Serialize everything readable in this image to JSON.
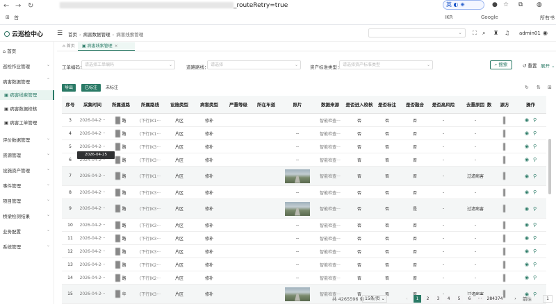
{
  "browser": {
    "url_tail": "_routeRetry=true",
    "bookmark_text": "首",
    "bookmark_ikrr": "IKR",
    "bookmark_google": "Google",
    "bookmark_all": "所有书",
    "translate_label": "英"
  },
  "app": {
    "title": "云巡检中心",
    "user": "admin01"
  },
  "breadcrumb": {
    "home": "首页",
    "level1": "病害数据管理",
    "current": "病害线索管理"
  },
  "tabs": {
    "home": "首页",
    "active": "病害线索管理",
    "close": "×"
  },
  "sidebar": {
    "home": "首页",
    "items": [
      "巡检作业管理",
      "病害数据管理",
      "评价数据管理",
      "资源管理",
      "设施资产管理",
      "事件管理",
      "项目管理",
      "桥梁检测结果",
      "业务配置",
      "系统管理"
    ],
    "subitems": [
      "病害线索管理",
      "病害数据校核",
      "病害工单管理"
    ]
  },
  "filters": {
    "order_label": "工单编码：",
    "order_placeholder": "请选择工单编码",
    "road_label": "道路路线：",
    "road_placeholder": "请选择",
    "asset_label": "资产标准类型：",
    "asset_placeholder": "请选择资产标准类型",
    "search": "搜索",
    "reset": "重置",
    "expand": "展开"
  },
  "actions": {
    "export": "导出",
    "marked": "已标注",
    "unmarked": "未标注"
  },
  "table": {
    "headers": [
      "序号",
      "采集时间",
      "所属道路",
      "所属路线",
      "设施类型",
      "病害类型",
      "严重等级",
      "所在车道",
      "照片",
      "数据来源",
      "是否进入校核",
      "是否标注",
      "是否融合",
      "是否高风险",
      "去重原因",
      "数",
      "源方",
      "操作"
    ],
    "rows": [
      {
        "no": "3",
        "time": "2026-04-2···",
        "road": "路",
        "route": "(下行)K1···",
        "fac": "片区",
        "type": "修补",
        "photo": "",
        "photo_on": false,
        "src": "智能检查···",
        "chk": "否",
        "mark": "否",
        "fuse": "否",
        "risk": "-",
        "reason": "-"
      },
      {
        "no": "4",
        "time": "2026-04-2···",
        "road": "路",
        "route": "(下行)K1···",
        "fac": "片区",
        "type": "修补",
        "photo": "--",
        "photo_on": false,
        "src": "智能检查···",
        "chk": "否",
        "mark": "否",
        "fuse": "否",
        "risk": "-",
        "reason": "-"
      },
      {
        "no": "5",
        "time": "2026-04-2···",
        "road": "路",
        "route": "(下行)K3···",
        "fac": "片区",
        "type": "修补",
        "photo": "--",
        "photo_on": false,
        "src": "智能检查···",
        "chk": "否",
        "mark": "否",
        "fuse": "否",
        "risk": "-",
        "reason": "-"
      },
      {
        "no": "6",
        "time": "2026-04-2···",
        "road": "路",
        "route": "(下行)K3···",
        "fac": "片区",
        "type": "修补",
        "photo": "--",
        "photo_on": false,
        "src": "智能检查···",
        "chk": "否",
        "mark": "否",
        "fuse": "否",
        "risk": "-",
        "reason": "-"
      },
      {
        "no": "7",
        "time": "2026-04-2···",
        "road": "路",
        "route": "(下行)K1···",
        "fac": "片区",
        "type": "修补",
        "photo": "",
        "photo_on": true,
        "src": "智能检查···",
        "chk": "否",
        "mark": "否",
        "fuse": "否",
        "risk": "-",
        "reason": "过滤病害"
      },
      {
        "no": "8",
        "time": "2026-04-2···",
        "road": "路",
        "route": "(下行)K3···",
        "fac": "片区",
        "type": "修补",
        "photo": "--",
        "photo_on": false,
        "src": "智能检查···",
        "chk": "否",
        "mark": "否",
        "fuse": "否",
        "risk": "-",
        "reason": "-"
      },
      {
        "no": "9",
        "time": "2026-04-2···",
        "road": "路",
        "route": "(下行)K3···",
        "fac": "片区",
        "type": "修补",
        "photo": "",
        "photo_on": true,
        "src": "智能检查···",
        "chk": "否",
        "mark": "否",
        "fuse": "是",
        "risk": "-",
        "reason": "过滤病害"
      },
      {
        "no": "10",
        "time": "2026-04-2···",
        "road": "路",
        "route": "(下行)K3···",
        "fac": "片区",
        "type": "修补",
        "photo": "--",
        "photo_on": false,
        "src": "智能检查···",
        "chk": "否",
        "mark": "否",
        "fuse": "否",
        "risk": "-",
        "reason": "-"
      },
      {
        "no": "11",
        "time": "2026-04-2···",
        "road": "路",
        "route": "(下行)K3···",
        "fac": "片区",
        "type": "修补",
        "photo": "--",
        "photo_on": false,
        "src": "智能检查···",
        "chk": "否",
        "mark": "否",
        "fuse": "否",
        "risk": "-",
        "reason": "-"
      },
      {
        "no": "12",
        "time": "2026-04-2···",
        "road": "路",
        "route": "(下行)K3···",
        "fac": "片区",
        "type": "修补",
        "photo": "--",
        "photo_on": false,
        "src": "智能检查···",
        "chk": "否",
        "mark": "否",
        "fuse": "否",
        "risk": "-",
        "reason": "-"
      },
      {
        "no": "13",
        "time": "2026-04-2···",
        "road": "路",
        "route": "(下行)K2···",
        "fac": "片区",
        "type": "修补",
        "photo": "--",
        "photo_on": false,
        "src": "智能检查···",
        "chk": "否",
        "mark": "否",
        "fuse": "否",
        "risk": "-",
        "reason": "-"
      },
      {
        "no": "14",
        "time": "2026-04-2···",
        "road": "路",
        "route": "(下行)K2···",
        "fac": "片区",
        "type": "修补",
        "photo": "--",
        "photo_on": false,
        "src": "智能检查···",
        "chk": "否",
        "mark": "否",
        "fuse": "否",
        "risk": "-",
        "reason": "-"
      },
      {
        "no": "15",
        "time": "2026-04-2···",
        "road": "华",
        "route": "(下行)K3···",
        "fac": "片区",
        "type": "修补",
        "photo": "",
        "photo_on": true,
        "src": "智能检查···",
        "chk": "否",
        "mark": "否",
        "fuse": "否",
        "risk": "-",
        "reason": "过滤病害"
      }
    ]
  },
  "tooltip": "2026-04-25 12:35:27",
  "pagination": {
    "total": "共 4265596 条",
    "page_size": "15条/页",
    "pages": [
      "1",
      "2",
      "3",
      "4",
      "5",
      "6",
      "···",
      "284374"
    ],
    "prev": "‹",
    "next": "›",
    "goto_label": "前往",
    "goto_value": "1"
  },
  "colors": {
    "accent": "#2a7a66"
  }
}
